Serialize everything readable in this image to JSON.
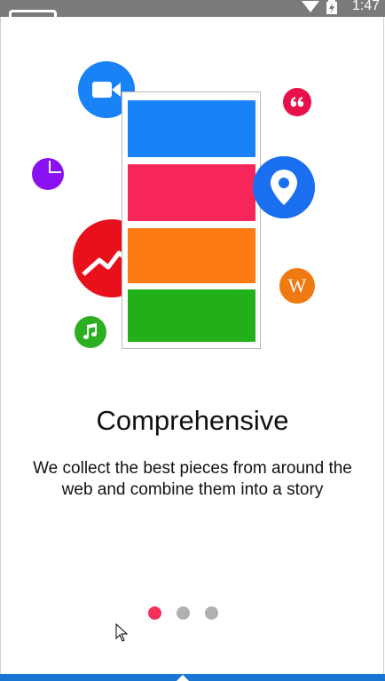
{
  "status_bar": {
    "time": "1:47"
  },
  "onboarding": {
    "title": "Comprehensive",
    "description": "We collect the best pieces from around the web and combine them into a story",
    "active_page": 0,
    "page_count": 3
  },
  "colors": {
    "blue": "#1a82f7",
    "pink": "#f7265a",
    "orange": "#fe7a12",
    "green": "#22b01a",
    "red": "#e8101a",
    "purple": "#8b12f0",
    "dot_active": "#f5305a",
    "dot_inactive": "#b0b0b0"
  },
  "icons": [
    "video-camera-icon",
    "quote-icon",
    "pie-chart-icon",
    "location-pin-icon",
    "trend-line-icon",
    "wikipedia-w-icon",
    "music-note-icon"
  ]
}
